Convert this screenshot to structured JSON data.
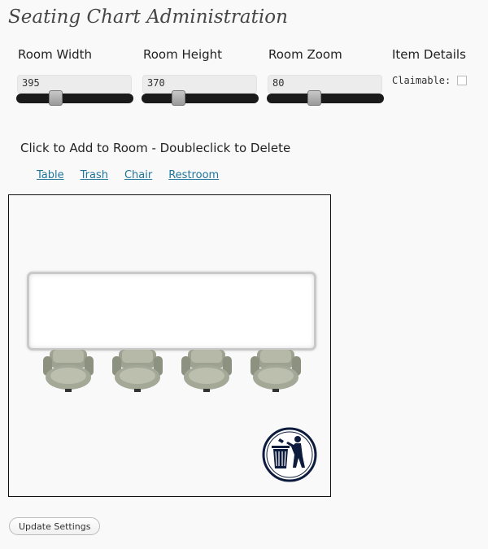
{
  "page": {
    "title": "Seating Chart Administration"
  },
  "controls": {
    "room_width": {
      "label": "Room Width",
      "value": "395",
      "level": 0.33
    },
    "room_height": {
      "label": "Room Height",
      "value": "370",
      "level": 0.31
    },
    "room_zoom": {
      "label": "Room Zoom",
      "value": "80",
      "level": 0.4
    }
  },
  "item_details": {
    "title": "Item Details",
    "claimable_label": "Claimable:",
    "claimable_checked": false
  },
  "instructions": "Click to Add to Room - Doubleclick to Delete",
  "toolbox": {
    "items": [
      "Table",
      "Trash",
      "Chair",
      "Restroom"
    ]
  },
  "room": {
    "items": [
      {
        "type": "table"
      },
      {
        "type": "chair"
      },
      {
        "type": "chair"
      },
      {
        "type": "chair"
      },
      {
        "type": "chair"
      },
      {
        "type": "trash",
        "icon": "trash-bin-icon"
      }
    ]
  },
  "update_button": "Update Settings"
}
